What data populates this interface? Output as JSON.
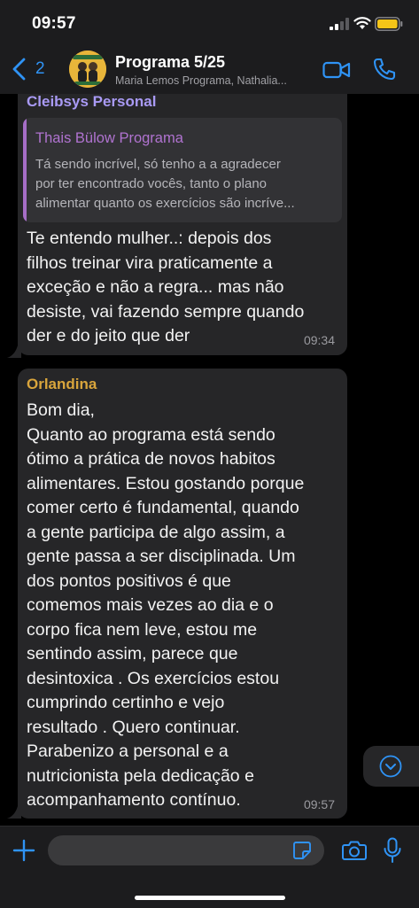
{
  "status_bar": {
    "time": "09:57"
  },
  "header": {
    "back_count": "2",
    "title": "Programa 5/25",
    "subtitle": "Maria Lemos Programa, Nathalia...",
    "icons": {
      "back": "chevron-left-icon",
      "video": "video-camera-icon",
      "call": "phone-icon"
    }
  },
  "messages": [
    {
      "sender": "Cleibsys Personal",
      "sender_color": "#a99af5",
      "quote": {
        "name": "Thais Bülow Programa",
        "name_color": "#b073d0",
        "text": "Tá sendo incrível, só tenho a a agradecer\npor ter encontrado vocês, tanto o plano\nalimentar quanto os exercícios são incríve..."
      },
      "text": "Te entendo mulher..: depois dos\nfilhos treinar vira praticamente a\nexceção e não a regra... mas não\ndesiste, vai fazendo sempre quando\nder e do jeito que der",
      "time": "09:34"
    },
    {
      "sender": "Orlandina",
      "sender_color": "#d9a53c",
      "text": "Bom dia,\nQuanto ao programa está sendo\nótimo  a prática  de novos habitos\nalimentares. Estou gostando porque\ncomer certo é fundamental,  quando\na gente participa de algo assim, a\ngente passa a ser disciplinada. Um\ndos pontos positivos é que\ncomemos mais vezes ao dia e o\ncorpo fica nem leve, estou me\nsentindo assim, parece que\ndesintoxica . Os exercícios  estou\ncumprindo certinho e vejo\nresultado . Quero continuar.\nParabenizo a personal e a\nnutricionista pela dedicação  e\nacompanhamento contínuo.",
      "time": "09:57"
    }
  ],
  "input_bar": {
    "placeholder": "",
    "icons": {
      "add": "plus-icon",
      "sticker": "sticker-icon",
      "camera": "camera-icon",
      "mic": "microphone-icon"
    }
  },
  "colors": {
    "accent": "#2f93f5",
    "bubble": "#262628",
    "background": "#000000",
    "bar": "#1c1c1e"
  }
}
